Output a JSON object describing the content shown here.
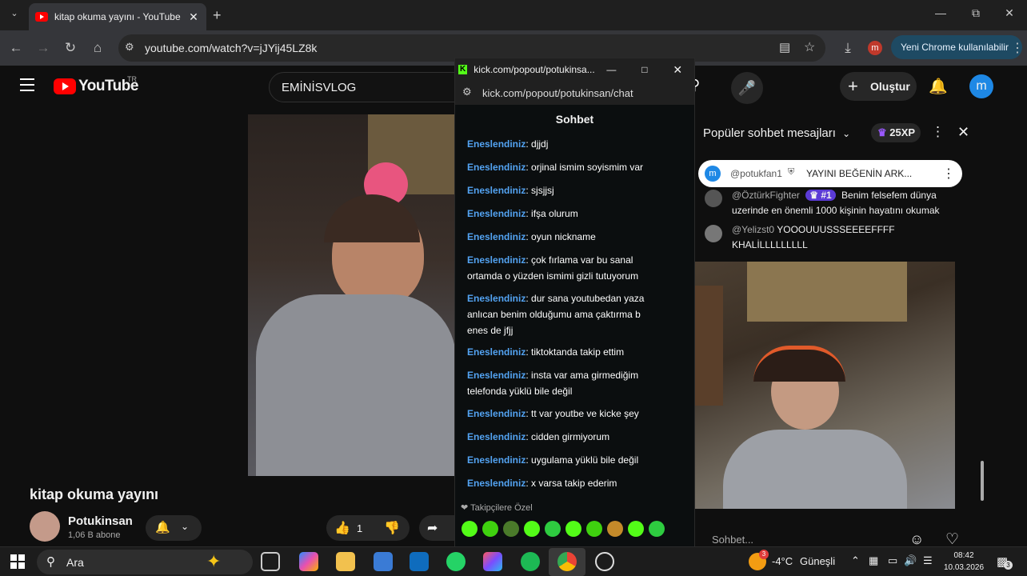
{
  "browser": {
    "tab_title": "kitap okuma yayını - YouTube",
    "url": "youtube.com/watch?v=jJYij45LZ8k",
    "profile_letter": "m",
    "new_chrome_label": "Yeni Chrome kullanılabilir"
  },
  "youtube": {
    "logo_text": "YouTube",
    "region": "TR",
    "search_value": "EMİNİSVLOG",
    "create_label": "Oluştur",
    "avatar_letter": "m",
    "video_title": "kitap okuma yayını",
    "channel_name": "Potukinsan",
    "subscribers": "1,06 B abone",
    "like_count": "1"
  },
  "kick_popup": {
    "window_title": "kick.com/popout/potukinsa...",
    "url": "kick.com/popout/potukinsan/chat",
    "chat_header": "Sohbet",
    "messages": [
      {
        "user": "Eneslendiniz",
        "text": "djjdj"
      },
      {
        "user": "Eneslendiniz",
        "text": "orjinal ismim soyismim var"
      },
      {
        "user": "Eneslendiniz",
        "text": "sjsjjsj"
      },
      {
        "user": "Eneslendiniz",
        "text": "ifşa olurum"
      },
      {
        "user": "Eneslendiniz",
        "text": "oyun nickname"
      },
      {
        "user": "Eneslendiniz",
        "text": "çok fırlama var bu sanal ortamda o yüzden ismimi gizli tutuyorum"
      },
      {
        "user": "Eneslendiniz",
        "text": "dur sana youtubedan yaza anlıcan benim olduğumu ama çaktırma b enes de jfjj"
      },
      {
        "user": "Eneslendiniz",
        "text": "tiktoktanda takip ettim"
      },
      {
        "user": "Eneslendiniz",
        "text": "insta var ama girmediğim telefonda yüklü bile değil"
      },
      {
        "user": "Eneslendiniz",
        "text": "tt var youtbe ve kicke şey"
      },
      {
        "user": "Eneslendiniz",
        "text": "cidden girmiyorum"
      },
      {
        "user": "Eneslendiniz",
        "text": "uygulama yüklü bile değil"
      },
      {
        "user": "Eneslendiniz",
        "text": "x varsa takip ederim"
      }
    ],
    "followers_label": "Takipçilere Özel"
  },
  "yt_chat": {
    "header": "Popüler sohbet mesajları",
    "xp_badge": "25XP",
    "pinned_author": "@potukfan1",
    "pinned_text": "YAYINI BEĞENİN ARK...",
    "messages": [
      {
        "author": "@ÖztürkFighter",
        "badge": "#1",
        "text": "Benim felsefem dünya uzerinde en önemli 1000 kişinin hayatını okumak"
      },
      {
        "author": "@Yelizst0",
        "badge": "",
        "text": "YOOOUUUSSSEEEEFFFF KHALİLLLLLLLLL"
      }
    ],
    "input_placeholder": "Sohbet..."
  },
  "taskbar": {
    "search_label": "Ara",
    "weather_temp": "-4°C",
    "weather_desc": "Güneşli",
    "time": "08:42",
    "date": "10.03.2026",
    "weather_badge": "3",
    "notif_badge": "3"
  }
}
